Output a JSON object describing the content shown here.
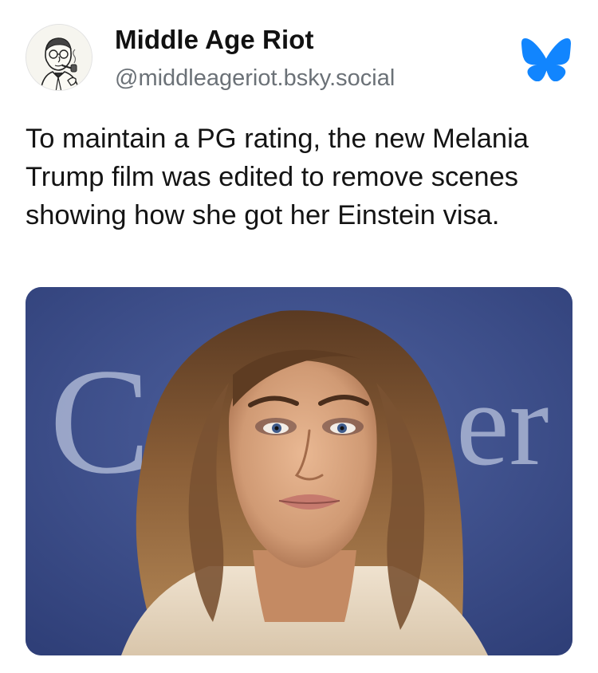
{
  "post": {
    "author_name": "Middle Age Riot",
    "author_handle": "@middleageriot.bsky.social",
    "text": "To maintain a PG rating, the new Melania Trump film was edited to remove scenes showing how she got her Einstein visa.",
    "avatar_icon": "cartoon-man-with-pipe-avatar",
    "platform_icon": "bluesky-butterfly-icon",
    "image": {
      "subject": "woman-portrait-photo",
      "background_text_left": "C",
      "background_text_right": "er"
    }
  },
  "colors": {
    "bluesky_blue": "#1185fe",
    "handle_gray": "#6b7177",
    "image_background_blue": "#3c4f8a"
  }
}
